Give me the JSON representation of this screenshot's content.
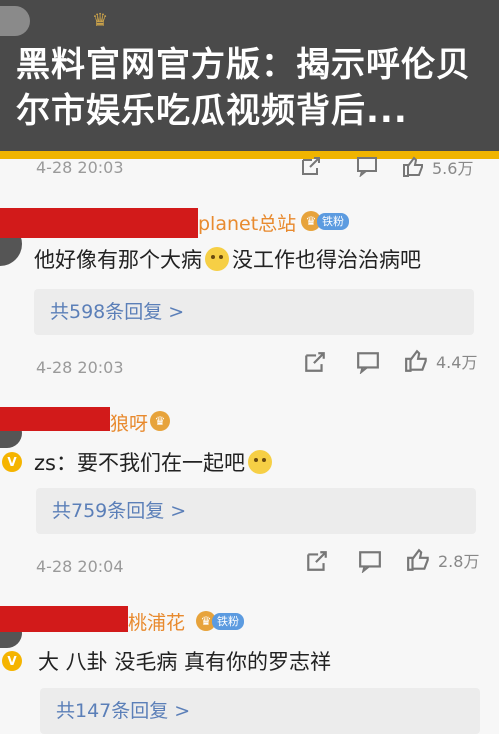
{
  "banner": {
    "title": "黑料官网官方版：揭示呼伦贝尔市娱乐吃瓜视频背后..."
  },
  "comments": [
    {
      "time": "4-28 20:03",
      "likes": "5.6万"
    },
    {
      "username": "planet总站",
      "badge": "铁粉",
      "text_before": "他好像有那个大病",
      "text_after": "没工作也得治治病吧",
      "replies": "共598条回复 >",
      "time": "4-28 20:03",
      "likes": "4.4万"
    },
    {
      "username": "狼呀",
      "text_before": "zs：要不我们在一起吧",
      "replies": "共759条回复 >",
      "time": "4-28 20:04",
      "likes": "2.8万"
    },
    {
      "username": "桃浦花",
      "badge": "铁粉",
      "text_before": "大 八卦 没毛病 真有你的罗志祥",
      "replies": "共147条回复 >"
    }
  ],
  "colors": {
    "banner_bg": "#4a4a4a",
    "accent_strip": "#f0b400",
    "reply_link": "#5b7fb8",
    "redaction": "#d21a1a"
  }
}
